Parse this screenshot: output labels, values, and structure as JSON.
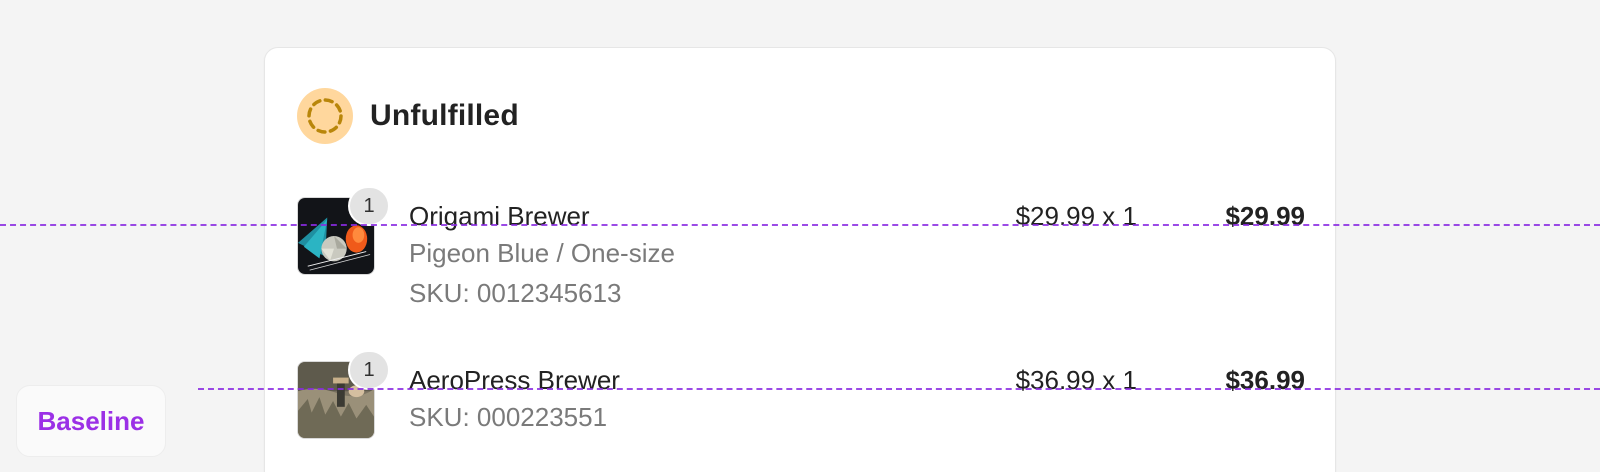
{
  "card": {
    "status_title": "Unfulfilled",
    "status_icon": "dashed-circle-icon",
    "status_color": "#ffd79d",
    "status_icon_color": "#b9860a"
  },
  "line_items": [
    {
      "quantity_badge": "1",
      "name": "Origami Brewer",
      "variant": "Pigeon Blue / One-size",
      "sku": "SKU: 0012345613",
      "unit_price": "$29.99 x 1",
      "total": "$29.99",
      "thumbnail": "origami-brewer-image"
    },
    {
      "quantity_badge": "1",
      "name": "AeroPress Brewer",
      "sku": "SKU: 000223551",
      "unit_price": "$36.99 x 1",
      "total": "$36.99",
      "thumbnail": "aeropress-brewer-image"
    }
  ],
  "overlay": {
    "baseline_label": "Baseline",
    "guide_color": "#8a2be2",
    "label_color": "#9b30e6"
  }
}
